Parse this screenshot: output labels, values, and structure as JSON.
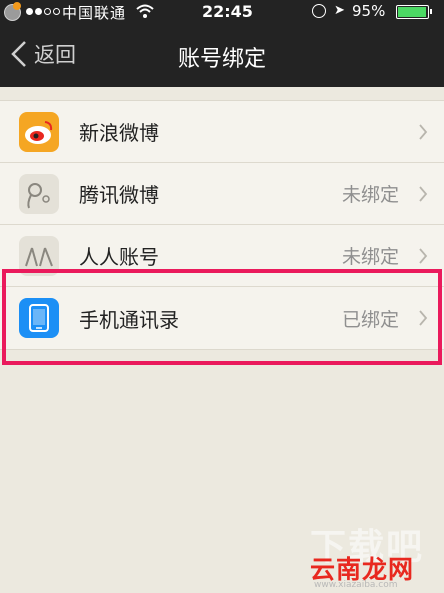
{
  "status_bar": {
    "carrier": "中国联通",
    "time": "22:45",
    "battery": "95%",
    "battery_level": 0.95
  },
  "nav": {
    "back_label": "返回",
    "title": "账号绑定"
  },
  "accounts": [
    {
      "name": "新浪微博",
      "status": "",
      "icon": "weibo-icon",
      "color": "#f5a623"
    },
    {
      "name": "腾讯微博",
      "status": "未绑定",
      "icon": "tencent-weibo-icon",
      "color": "#e4e1d8"
    },
    {
      "name": "人人账号",
      "status": "未绑定",
      "icon": "renren-icon",
      "color": "#e4e1d8"
    },
    {
      "name": "手机通讯录",
      "status": "已绑定",
      "icon": "phone-contacts-icon",
      "color": "#1c8ff5"
    }
  ],
  "highlight_color": "#ea1a5c",
  "watermark": {
    "title": "云南龙网",
    "url": "www.xiazaiba.com"
  }
}
